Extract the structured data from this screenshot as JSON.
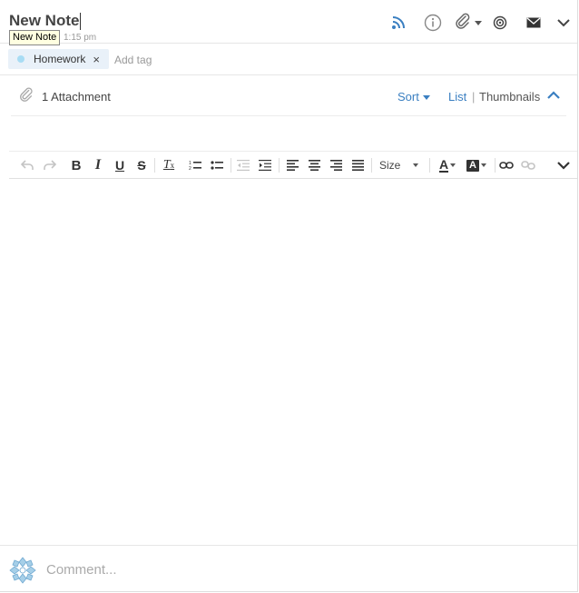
{
  "header": {
    "title": "New Note",
    "timestamp": "1:15 pm",
    "tooltip": "New Note",
    "icons": [
      "feed-icon",
      "info-icon",
      "paperclip-icon",
      "target-icon",
      "envelope-icon",
      "chevron-down-icon"
    ]
  },
  "tags": {
    "items": [
      {
        "label": "Homework",
        "color": "#a8dcf4"
      }
    ],
    "remove_glyph": "×",
    "add_placeholder": "Add tag"
  },
  "attachments": {
    "count_label": "1 Attachment",
    "sort_label": "Sort",
    "list_label": "List",
    "separator": "|",
    "thumbnails_label": "Thumbnails"
  },
  "toolbar": {
    "size_label": "Size",
    "tools": [
      "undo",
      "redo",
      "bold",
      "italic",
      "underline",
      "strikethrough",
      "remove-format",
      "numbered-list",
      "bulleted-list",
      "decrease-indent",
      "increase-indent",
      "align-left",
      "align-center",
      "align-right",
      "justify",
      "size",
      "text-color",
      "background-color",
      "link",
      "unlink",
      "more"
    ]
  },
  "comment": {
    "placeholder": "Comment..."
  },
  "colors": {
    "accent": "#3a7fc1",
    "tag_background": "#e9f1f9",
    "tooltip_background": "#ffffe1"
  }
}
